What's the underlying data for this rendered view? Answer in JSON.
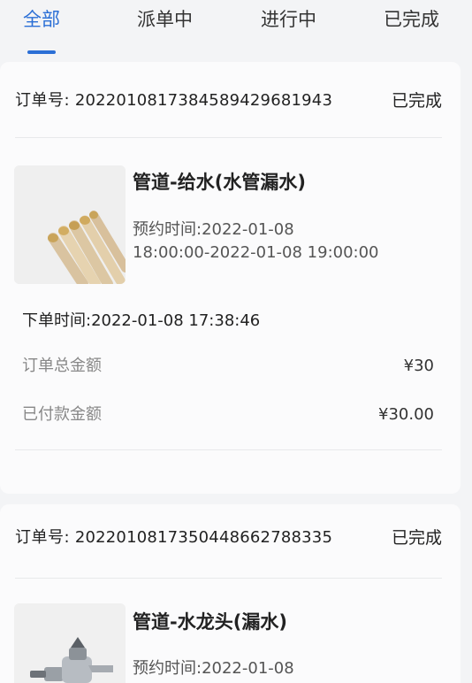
{
  "tabs": [
    {
      "label": "全部",
      "active": true
    },
    {
      "label": "派单中",
      "active": false
    },
    {
      "label": "进行中",
      "active": false
    },
    {
      "label": "已完成",
      "active": false
    }
  ],
  "orders": [
    {
      "order_label": "订单号:",
      "order_number": "2022010817384589429681943",
      "status": "已完成",
      "service_title": "管道-给水(水管漏水)",
      "image_icon": "pipes-image",
      "appointment_line1": "预约时间:2022-01-08",
      "appointment_line2": "18:00:00-2022-01-08 19:00:00",
      "create_time": "下单时间:2022-01-08 17:38:46",
      "total_label": "订单总金额",
      "total_value": "¥30",
      "paid_label": "已付款金额",
      "paid_value": "¥30.00"
    },
    {
      "order_label": "订单号:",
      "order_number": "2022010817350448662788335",
      "status": "已完成",
      "service_title": "管道-水龙头(漏水)",
      "image_icon": "faucet-image",
      "appointment_line1": "预约时间:2022-01-08"
    }
  ],
  "colors": {
    "accent": "#2b6fd6",
    "background": "#f3f4f6",
    "card": "#fbfbfc"
  }
}
